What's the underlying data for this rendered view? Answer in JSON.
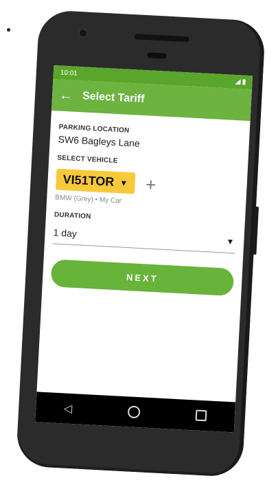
{
  "status_bar": {
    "time": "10:01"
  },
  "app_bar": {
    "title": "Select Tariff",
    "back_icon": "arrow-left-icon"
  },
  "parking": {
    "label": "PARKING LOCATION",
    "value": "SW6 Bagleys Lane"
  },
  "vehicle": {
    "label": "SELECT VEHICLE",
    "plate": "VI51TOR",
    "meta": "BMW (Grey) • My Car",
    "add_icon": "plus-icon"
  },
  "duration": {
    "label": "DURATION",
    "value": "1 day"
  },
  "actions": {
    "next_label": "NEXT"
  },
  "colors": {
    "accent": "#6cb33f",
    "status_bar": "#5aa52b",
    "plate": "#f8c93a",
    "nav_bar": "#000000"
  },
  "nav": {
    "back_icon": "triangle-back-icon",
    "home_icon": "circle-home-icon",
    "recent_icon": "square-recent-icon"
  }
}
